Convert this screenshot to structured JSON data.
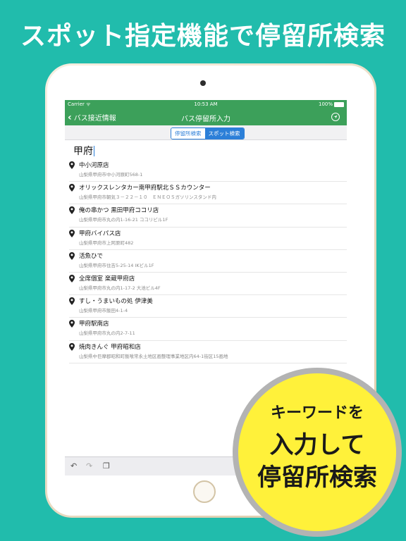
{
  "headline": "スポット指定機能で停留所検索",
  "status_bar": {
    "carrier": "Carrier ᯤ",
    "time": "10:53 AM",
    "battery": "100%"
  },
  "nav": {
    "back_label": "バス接近情報",
    "title": "バス停留所入力",
    "location_icon": "location-arrow-icon"
  },
  "segments": [
    {
      "label": "停留所検索",
      "selected": false
    },
    {
      "label": "スポット検索",
      "selected": true
    }
  ],
  "search": {
    "value": "甲府"
  },
  "results": [
    {
      "name": "中小河原店",
      "address": "山梨県甲府市中小河原町568-1"
    },
    {
      "name": "オリックスレンタカー南甲府駅北ＳＳカウンター",
      "address": "山梨県甲府市朝気３－２２－１０　ＥＮＥＯＳガソリンスタンド内"
    },
    {
      "name": "俺の串かつ 黒田甲府ココリ店",
      "address": "山梨県甲府市丸の内1-16-21 ココリビル1F"
    },
    {
      "name": "甲府バイパス店",
      "address": "山梨県甲府市上阿原町482"
    },
    {
      "name": "活魚ひで",
      "address": "山梨県甲府市住吉5-25-14 IKビル1F"
    },
    {
      "name": "全席個室 楽蔵甲府店",
      "address": "山梨県甲府市丸の内1-17-2 大池ビル4F"
    },
    {
      "name": "すし・うまいもの処 伊津美",
      "address": "山梨県甲府市飯田4-1-4"
    },
    {
      "name": "甲府駅南店",
      "address": "山梨県甲府市丸の内2-7-11"
    },
    {
      "name": "焼肉きんぐ 甲府昭和店",
      "address": "山梨県中巨摩郡昭和町飯喰常永土地区画整理事業地区内64-1街区15画地"
    }
  ],
  "badge": {
    "line1": "キーワードを",
    "line2": "入力して",
    "line3": "停留所検索"
  },
  "colors": {
    "background": "#21bcac",
    "nav": "#3ca05a",
    "accent": "#2c7fd8",
    "badge": "#fff13a"
  }
}
